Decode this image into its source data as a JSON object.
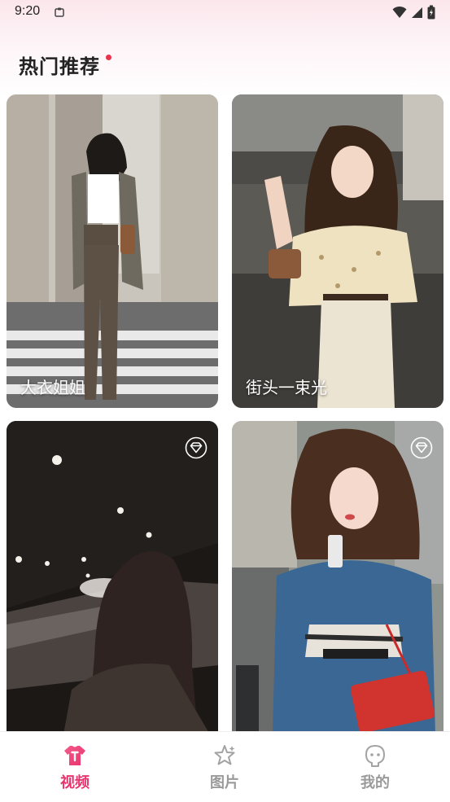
{
  "status_bar": {
    "time": "9:20"
  },
  "section": {
    "title": "热门推荐"
  },
  "cards": [
    {
      "label": "大衣姐姐",
      "vip": false
    },
    {
      "label": "街头一束光",
      "vip": false
    },
    {
      "label": "",
      "vip": true
    },
    {
      "label": "",
      "vip": true
    }
  ],
  "nav": {
    "items": [
      {
        "label": "视频",
        "icon": "tshirt-icon",
        "active": true
      },
      {
        "label": "图片",
        "icon": "sparkle-star-icon",
        "active": false
      },
      {
        "label": "我的",
        "icon": "profile-face-icon",
        "active": false
      }
    ]
  },
  "colors": {
    "accent": "#e8336d",
    "inactive": "#9a9a9a",
    "title_dot": "#e8334a"
  }
}
